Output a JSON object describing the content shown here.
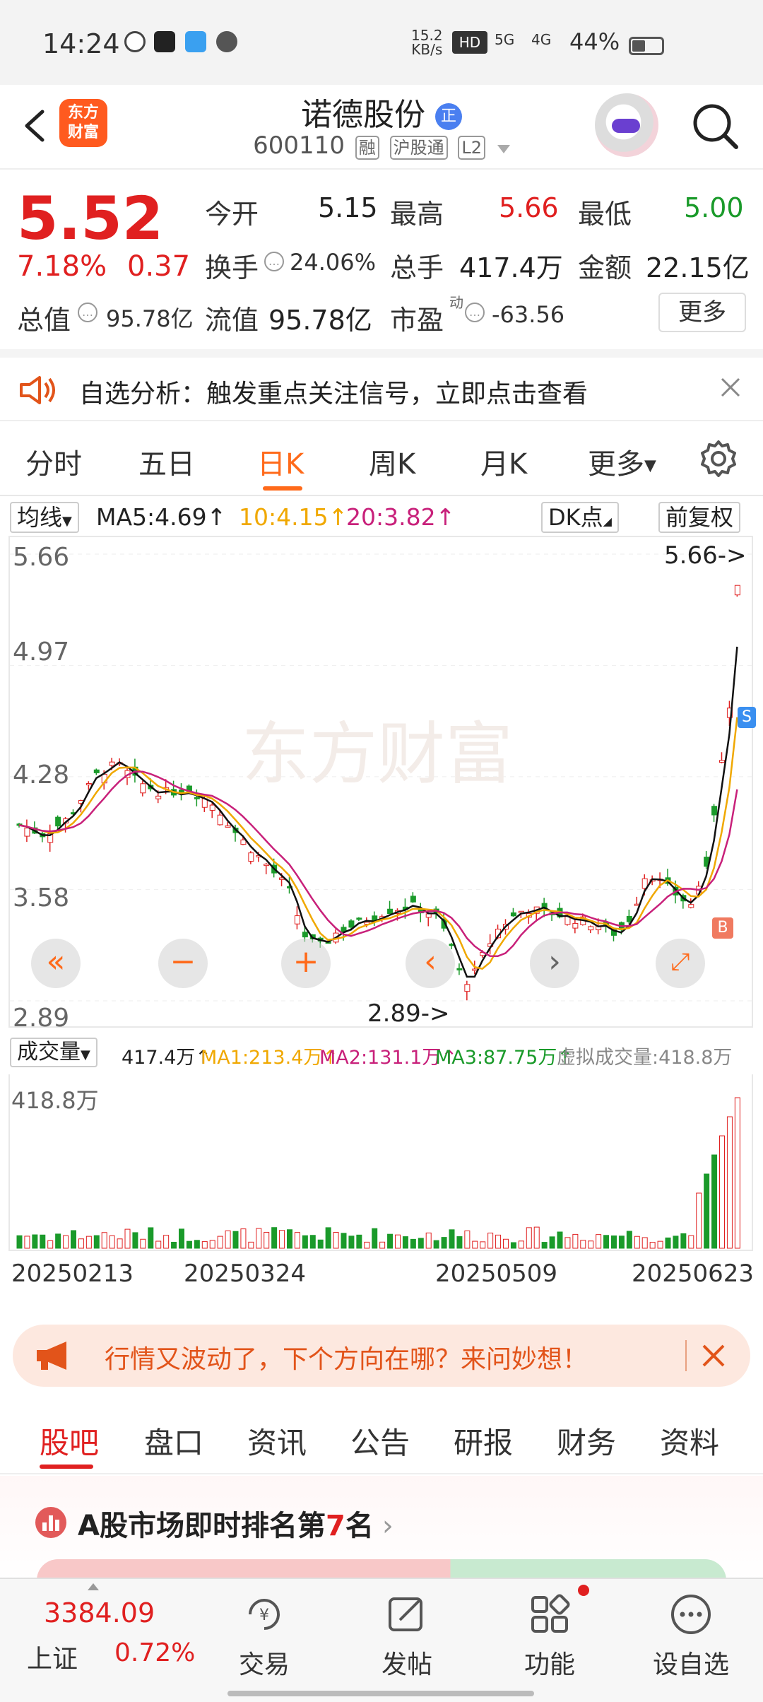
{
  "status": {
    "time": "14:24",
    "net_speed": "15.2",
    "net_unit": "KB/s",
    "battery": "44%",
    "network": "4G"
  },
  "header": {
    "stock_name": "诺德股份",
    "stock_code": "600110",
    "tags": [
      "融",
      "沪股通",
      "L2"
    ],
    "logo_line1": "东方",
    "logo_line2": "财富"
  },
  "quote": {
    "price": "5.52",
    "pct": "7.18%",
    "change": "0.37",
    "open_label": "今开",
    "open": "5.15",
    "high_label": "最高",
    "high": "5.66",
    "low_label": "最低",
    "low": "5.00",
    "turnover_label": "换手",
    "turnover": "24.06%",
    "volume_label": "总手",
    "volume": "417.4万",
    "amount_label": "金额",
    "amount": "22.15亿",
    "total_value_label": "总值",
    "total_value": "95.78亿",
    "float_value_label": "流值",
    "float_value": "95.78亿",
    "pe_label": "市盈",
    "pe_sup": "动",
    "pe": "-63.56",
    "more": "更多"
  },
  "notice": {
    "text": "自选分析：触发重点关注信号，立即点击查看"
  },
  "ktabs": [
    "分时",
    "五日",
    "日K",
    "周K",
    "月K",
    "更多"
  ],
  "ma": {
    "type": "均线",
    "ma5": "MA5:4.69",
    "ma10": "10:4.15",
    "ma20": "20:3.82",
    "dk": "DK点",
    "adjust": "前复权"
  },
  "chart": {
    "y_labels": [
      "5.66",
      "4.97",
      "4.28",
      "3.58",
      "2.89"
    ],
    "max_mark": "5.66->",
    "min_mark": "2.89->",
    "watermark": "东方财富",
    "badge_s": "S",
    "badge_b": "B"
  },
  "volume": {
    "label": "成交量",
    "vol": "417.4万",
    "ma1": "MA1:213.4万",
    "ma2": "MA2:131.1万",
    "ma3": "MA3:87.75万",
    "virtual": "虚拟成交量:418.8万",
    "max": "418.8万"
  },
  "dates": [
    "20250213",
    "20250324",
    "20250509",
    "20250623"
  ],
  "banner": {
    "text": "行情又波动了，下个方向在哪？来问妙想！"
  },
  "btabs": [
    "股吧",
    "盘口",
    "资讯",
    "公告",
    "研报",
    "财务",
    "资料"
  ],
  "rank": {
    "prefix": "A股市场即时排名第",
    "num": "7",
    "suffix": "名"
  },
  "bottomnav": {
    "index_value": "3384.09",
    "index_name": "上证",
    "index_pct": "0.72%",
    "items": [
      "交易",
      "发帖",
      "功能",
      "设自选"
    ]
  },
  "colors": {
    "up": "#e02020",
    "down": "#1a9a2a",
    "accent": "#ff6a1a",
    "ma5": "#111111",
    "ma10": "#f0a800",
    "ma20": "#c8207a"
  }
}
